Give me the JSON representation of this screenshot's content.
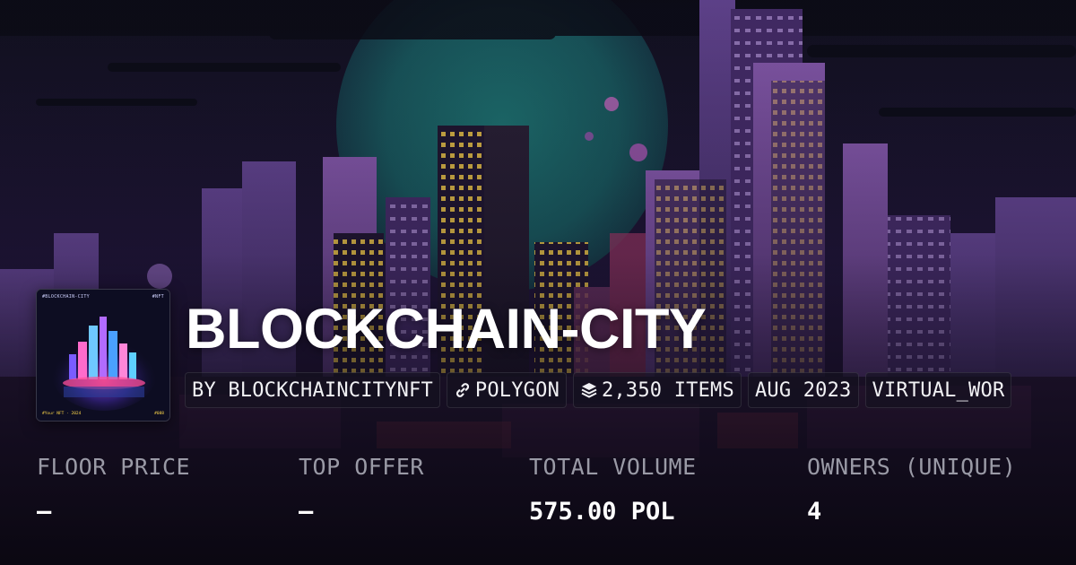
{
  "collection": {
    "title": "BLOCKCHAIN-CITY",
    "thumbnail": {
      "top_left": "#BLOCKCHAIN-CITY",
      "top_right": "#NFT",
      "bottom_left": "#Your NFT · 2024",
      "bottom_right": "#088"
    }
  },
  "chips": [
    {
      "icon": "none",
      "label": "BY BLOCKCHAINCITYNFT"
    },
    {
      "icon": "link-icon",
      "label": "POLYGON"
    },
    {
      "icon": "layers-icon",
      "label": "2,350 ITEMS"
    },
    {
      "icon": "none",
      "label": "AUG 2023"
    },
    {
      "icon": "none",
      "label": "VIRTUAL_WOR"
    }
  ],
  "stats": [
    {
      "label": "FLOOR PRICE",
      "value": "–"
    },
    {
      "label": "TOP OFFER",
      "value": "–"
    },
    {
      "label": "TOTAL VOLUME",
      "value": "575.00 POL"
    },
    {
      "label": "OWNERS (UNIQUE)",
      "value": "4"
    }
  ],
  "colors": {
    "title": "#ffffff",
    "stat_label": "#9a9aa6",
    "stat_value": "#ffffff",
    "chip_bg": "#14121e"
  }
}
